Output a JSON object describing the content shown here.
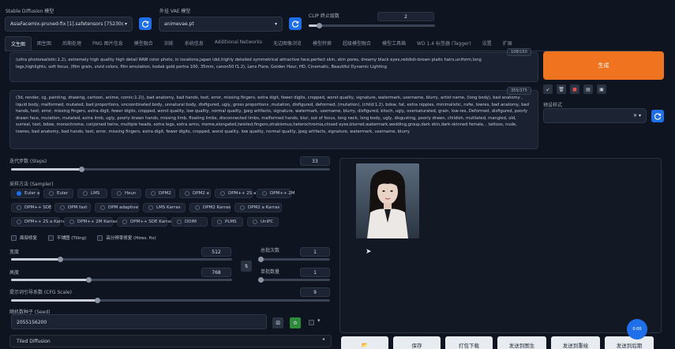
{
  "header": {
    "model_label": "Stable Diffusion 模型",
    "model_value": "AsiaFacemix-pruned-fix [1].safetensors [75230c",
    "vae_label": "外挂 VAE 模型",
    "vae_value": "animevae.pt",
    "clip_label": "CLIP 终止层数",
    "clip_value": "2",
    "clip_level": 0.08
  },
  "tabs": [
    "文生图",
    "图生图",
    "后期处理",
    "PNG 图片信息",
    "模型融合",
    "训练",
    "系统信息",
    "Additional Networks",
    "无边图像浏览",
    "模型转换",
    "超级模型融合",
    "模型工具箱",
    "WD 1.4 标签器 (Tagger)",
    "设置",
    "扩展"
  ],
  "prompt": {
    "text": "(ultra photorealistic:1.2), extremely high quality high detail RAW color photo, in locations,japan idol,highly detailed symmetrical attractive face,perfect skin, skin pores, dreamy black eyes,reddish-brown plaits hairs,uniform,long legs,highlights, soft focus, (film grain, vivid colors, film emulation, kodak gold portra 100, 35mm, canon50 f1.2), Lens Flare, Golden Hour, HD, Cinematic, Beautiful Dynamic Lighting",
    "counter": "108/150"
  },
  "negative": {
    "text": "(3d, render, cg, painting, drawing, cartoon, anime, comic:1.2)), bad anatomy, bad hands, text, error, missing fingers, extra digit, fewer digits, cropped, worst quality, signature, watermark, username, blurry, artist name, (long body), bad anatomy , liquid body, malformed, mutated, bad proportions, uncoordinated body, unnatural body, disfigured, ugly, gross proportions ,mutation, disfigured, deformed, (mutation), (child:1.2), bdsw, fat, extra nipples, minimalistic, nsfw, lowres, bad anatomy, bad hands, text, error, missing fingers, extra digit, fewer digits, cropped, worst quality, low quality, normal quality, jpeg artifacts, signature, watermark, username, blurry, disfigured, kitsch, ugly, oversaturated, grain, low-res, Deformed, disfigured, poorly drawn face, mutation, mutated, extra limb, ugly, poorly drawn hands, missing limb, floating limbs, disconnected limbs, malformed hands, blur, out of focus, long neck, long body, ugly, disgusting, poorly drawn, childish, mutilated, mangled, old, surreal, text, bdsw, monochrome, conjoined twins, multiple heads, extra legs, extra arms, meme,elongated,twisted,fingers,strabismus,heterochromia,closed eyes,blurred,watermark,wedding,group,dark skin,dark-skinned female, , tattoos, nude, lowres, bad anatomy, bad hands, text, error, missing fingers, extra digit, fewer digits, cropped, worst quality, low quality, normal quality, jpeg artifacts, signature, watermark, username, blurry",
    "counter": "355/375"
  },
  "generate": {
    "label": "生成"
  },
  "style": {
    "label": "预设样式"
  },
  "steps": {
    "label": "迭代步数 (Steps)",
    "value": "33",
    "fraction": 0.22
  },
  "sampler": {
    "label": "采样方法 (Sampler)",
    "selected": "Euler a",
    "options": [
      "Euler a",
      "Euler",
      "LMS",
      "Heun",
      "DPM2",
      "DPM2 a",
      "DPM++ 2S a",
      "DPM++ 2M",
      "DPM++ SDE",
      "DPM fast",
      "DPM adaptive",
      "LMS Karras",
      "DPM2 Karras",
      "DPM2 a Karras",
      "DPM++ 2S a Karras",
      "DPM++ 2M Karras",
      "DPM++ SDE Karras",
      "DDIM",
      "PLMS",
      "UniPC"
    ]
  },
  "checks": [
    "面部修复",
    "平铺图 (Tiling)",
    "高分辨率修复 (Hires. fix)"
  ],
  "width": {
    "label": "宽度",
    "value": "512",
    "fraction": 0.22
  },
  "height": {
    "label": "高度",
    "value": "768",
    "fraction": 0.35
  },
  "batch_count": {
    "label": "总批次数",
    "value": "1",
    "fraction": 0.0
  },
  "batch_size": {
    "label": "单批数量",
    "value": "1",
    "fraction": 0.0
  },
  "cfg": {
    "label": "提示词引导系数 (CFG Scale)",
    "value": "9",
    "fraction": 0.27
  },
  "seed": {
    "label": "随机数种子 (Seed)",
    "value": "2055156200"
  },
  "tiled": {
    "label": "Tiled Diffusion"
  },
  "bottom_buttons": [
    "",
    "保存",
    "打包下载",
    "发送到图生",
    "发送到重绘",
    "发送到后期"
  ],
  "badge": "0:00"
}
